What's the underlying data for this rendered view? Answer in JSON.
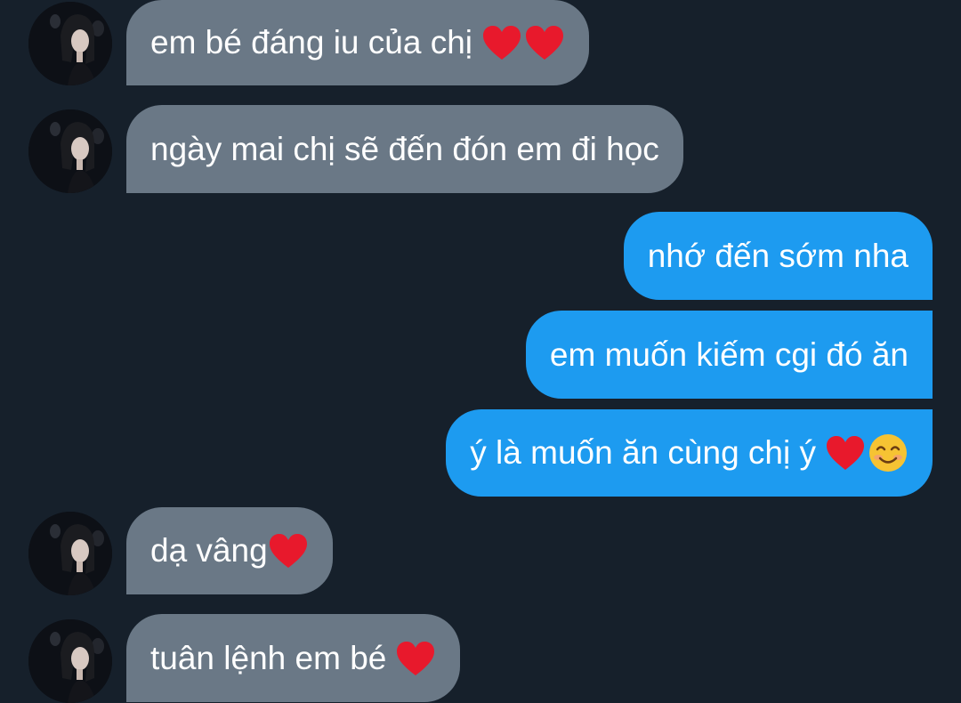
{
  "conversation": {
    "messages": [
      {
        "sender": "other",
        "text": "em bé đáng iu của chị",
        "emojis": [
          "heart-icon",
          "heart-icon"
        ]
      },
      {
        "sender": "other",
        "text": "ngày mai chị sẽ đến đón em đi học",
        "emojis": []
      },
      {
        "sender": "me",
        "text": "nhớ đến sớm nha",
        "emojis": []
      },
      {
        "sender": "me",
        "text": "em muốn kiếm cgi đó ăn",
        "emojis": []
      },
      {
        "sender": "me",
        "text": "ý là muốn ăn cùng chị ý",
        "emojis": [
          "heart-icon",
          "smiling-face-icon"
        ]
      },
      {
        "sender": "other",
        "text": "dạ vâng",
        "emojis": [
          "heart-icon"
        ]
      },
      {
        "sender": "other",
        "text": "tuân lệnh em bé",
        "emojis": [
          "heart-icon"
        ]
      }
    ]
  },
  "colors": {
    "background": "#16202b",
    "incoming_bubble": "#6a7886",
    "outgoing_bubble": "#1d9bf0",
    "text": "#ffffff",
    "heart": "#e8192c"
  }
}
